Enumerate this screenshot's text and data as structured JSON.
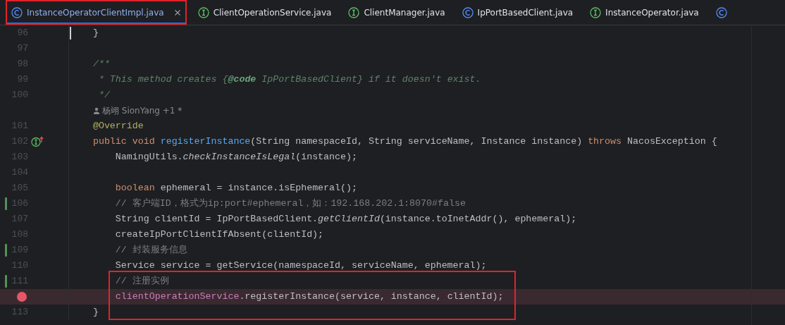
{
  "tabs": [
    {
      "kind": "class",
      "label": "InstanceOperatorClientImpl.java",
      "selected": true,
      "framed": true
    },
    {
      "kind": "interface",
      "label": "ClientOperationService.java",
      "selected": false,
      "framed": false
    },
    {
      "kind": "interface",
      "label": "ClientManager.java",
      "selected": false,
      "framed": false
    },
    {
      "kind": "class",
      "label": "IpPortBasedClient.java",
      "selected": false,
      "framed": false
    },
    {
      "kind": "interface",
      "label": "InstanceOperator.java",
      "selected": false,
      "framed": false
    },
    {
      "kind": "class",
      "selected": false,
      "framed": false
    }
  ],
  "lines": [
    {
      "kind": "code",
      "number": "96",
      "tokens": [
        {
          "kind": "plain",
          "text": "    }"
        }
      ],
      "changed": false,
      "breakpoint": false,
      "current": false,
      "framed": false
    },
    {
      "kind": "code",
      "number": "97",
      "changed": false,
      "breakpoint": false,
      "current": false,
      "framed": false
    },
    {
      "kind": "code",
      "number": "98",
      "tokens": [
        {
          "kind": "doc",
          "text": "    /**"
        }
      ],
      "changed": false,
      "breakpoint": false,
      "current": false,
      "framed": false
    },
    {
      "kind": "code",
      "number": "99",
      "tokens": [
        {
          "kind": "doc",
          "text": "     * This method creates {"
        },
        {
          "kind": "doctag",
          "text": "@code"
        },
        {
          "kind": "doc",
          "text": " IpPortBasedClient} if it doesn't exist."
        }
      ],
      "changed": false,
      "breakpoint": false,
      "current": false,
      "framed": false
    },
    {
      "kind": "code",
      "number": "100",
      "tokens": [
        {
          "kind": "doc",
          "text": "     */"
        }
      ],
      "changed": false,
      "breakpoint": false,
      "current": false,
      "framed": false
    },
    {
      "kind": "author",
      "text": "杨翊 SionYang +1 *"
    },
    {
      "kind": "code",
      "number": "101",
      "tokens": [
        {
          "kind": "annotation",
          "text": "    @Override"
        }
      ],
      "changed": false,
      "breakpoint": false,
      "current": false,
      "framed": false
    },
    {
      "kind": "code",
      "number": "102",
      "gutter": {
        "kind": "implements"
      },
      "tokens": [
        {
          "kind": "keyword",
          "text": "    public void "
        },
        {
          "kind": "function",
          "text": "registerInstance"
        },
        {
          "kind": "plain",
          "text": "(String namespaceId, String serviceName, Instance instance) "
        },
        {
          "kind": "keyword",
          "text": "throws"
        },
        {
          "kind": "plain",
          "text": " NacosException {"
        }
      ],
      "changed": false,
      "breakpoint": false,
      "current": false,
      "framed": false
    },
    {
      "kind": "code",
      "number": "103",
      "tokens": [
        {
          "kind": "plain",
          "text": "        NamingUtils."
        },
        {
          "kind": "static",
          "text": "checkInstanceIsLegal"
        },
        {
          "kind": "plain",
          "text": "(instance);"
        }
      ],
      "changed": false,
      "breakpoint": false,
      "current": false,
      "framed": false
    },
    {
      "kind": "code",
      "number": "104",
      "changed": false,
      "breakpoint": false,
      "current": false,
      "framed": false
    },
    {
      "kind": "code",
      "number": "105",
      "tokens": [
        {
          "kind": "keyword",
          "text": "        boolean"
        },
        {
          "kind": "plain",
          "text": " ephemeral = instance.isEphemeral();"
        }
      ],
      "changed": false,
      "breakpoint": false,
      "current": false,
      "framed": false
    },
    {
      "kind": "code",
      "number": "106",
      "tokens": [
        {
          "kind": "comment",
          "text": "        // 客户端ID，格式为ip:port#ephemeral，如：192.168.202.1:8070#false"
        }
      ],
      "changed": true,
      "breakpoint": false,
      "current": false,
      "framed": false
    },
    {
      "kind": "code",
      "number": "107",
      "tokens": [
        {
          "kind": "plain",
          "text": "        String clientId = IpPortBasedClient."
        },
        {
          "kind": "static",
          "text": "getClientId"
        },
        {
          "kind": "plain",
          "text": "(instance.toInetAddr(), ephemeral);"
        }
      ],
      "changed": false,
      "breakpoint": false,
      "current": false,
      "framed": false
    },
    {
      "kind": "code",
      "number": "108",
      "tokens": [
        {
          "kind": "plain",
          "text": "        createIpPortClientIfAbsent(clientId);"
        }
      ],
      "changed": false,
      "breakpoint": false,
      "current": false,
      "framed": false
    },
    {
      "kind": "code",
      "number": "109",
      "tokens": [
        {
          "kind": "comment",
          "text": "        // 封装服务信息"
        }
      ],
      "changed": true,
      "breakpoint": false,
      "current": false,
      "framed": false
    },
    {
      "kind": "code",
      "number": "110",
      "tokens": [
        {
          "kind": "plain",
          "text": "        Service service = getService(namespaceId, serviceName, ephemeral);"
        }
      ],
      "changed": false,
      "breakpoint": false,
      "current": false,
      "framed": false
    },
    {
      "kind": "code",
      "number": "111",
      "tokens": [
        {
          "kind": "comment",
          "text": "        // 注册实例"
        }
      ],
      "changed": true,
      "breakpoint": false,
      "current": false,
      "framed": true
    },
    {
      "kind": "code",
      "tokens": [
        {
          "kind": "field",
          "text": "        clientOperationService"
        },
        {
          "kind": "plain",
          "text": ".registerInstance(service, instance, clientId);"
        }
      ],
      "changed": false,
      "breakpoint": true,
      "current": true,
      "framed": true
    },
    {
      "kind": "code",
      "number": "113",
      "tokens": [
        {
          "kind": "plain",
          "text": "    }"
        }
      ],
      "changed": false,
      "breakpoint": false,
      "current": false,
      "framed": true
    }
  ]
}
